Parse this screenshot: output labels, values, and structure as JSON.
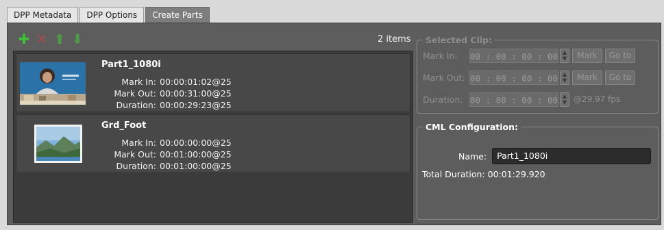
{
  "tabs": [
    {
      "label": "DPP Metadata",
      "active": false
    },
    {
      "label": "DPP Options",
      "active": false
    },
    {
      "label": "Create Parts",
      "active": true
    }
  ],
  "toolbar": {
    "icons": [
      "add-icon",
      "delete-icon",
      "move-up-icon",
      "move-down-icon"
    ],
    "item_count": "2 items"
  },
  "clips": [
    {
      "title": "Part1_1080i",
      "mark_in_label": "Mark In:",
      "mark_in": "00:00:01:02@25",
      "mark_out_label": "Mark Out:",
      "mark_out": "00:00:31:00@25",
      "duration_label": "Duration:",
      "duration": "00:00:29:23@25"
    },
    {
      "title": "Grd_Foot",
      "mark_in_label": "Mark In:",
      "mark_in": "00:00:00:00@25",
      "mark_out_label": "Mark Out:",
      "mark_out": "00:01:00:00@25",
      "duration_label": "Duration:",
      "duration": "00:01:00:00@25"
    }
  ],
  "selected_clip": {
    "title": "Selected Clip:",
    "mark_in_label": "Mark In:",
    "mark_in_value": "00 : 00 : 00 : 00",
    "mark_out_label": "Mark Out:",
    "mark_out_value": "00 : 00 : 00 : 00",
    "duration_label": "Duration:",
    "duration_value": "00 : 00 : 00 : 00",
    "mark_button": "Mark",
    "goto_button": "Go to",
    "fps": "@29.97 fps"
  },
  "cml": {
    "title": "CML Configuration:",
    "name_label": "Name:",
    "name_value": "Part1_1080i",
    "total_duration_label": "Total Duration:",
    "total_duration_value": "00:01:29.920"
  },
  "colors": {
    "add": "#3fbf3a",
    "delete": "#b04646",
    "move": "#4f9a4a"
  }
}
